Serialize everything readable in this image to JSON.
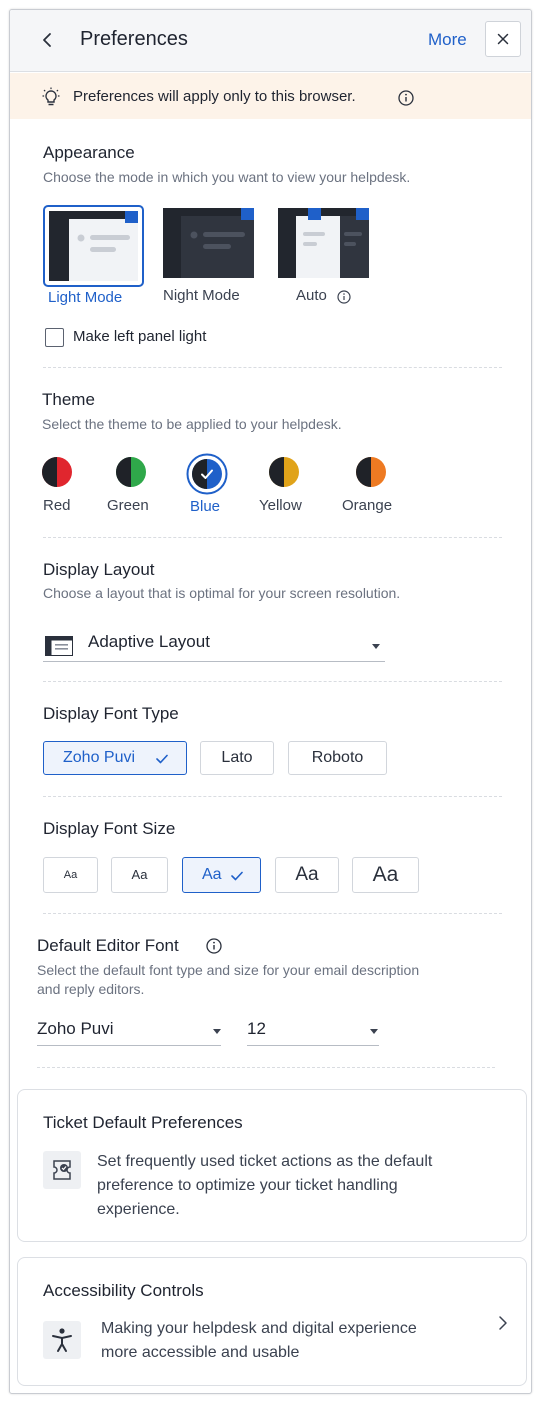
{
  "header": {
    "title": "Preferences",
    "more_label": "More"
  },
  "notice": {
    "text": "Preferences will apply only to this browser."
  },
  "appearance": {
    "title": "Appearance",
    "description": "Choose the mode in which you want to view your helpdesk.",
    "modes": [
      {
        "label": "Light Mode",
        "selected": true
      },
      {
        "label": "Night Mode",
        "selected": false
      },
      {
        "label": "Auto",
        "selected": false
      }
    ],
    "left_panel_label": "Make left panel light",
    "left_panel_checked": false
  },
  "theme": {
    "title": "Theme",
    "description": "Select the theme to be applied to your helpdesk.",
    "options": [
      {
        "label": "Red",
        "color": "#e0262e",
        "selected": false
      },
      {
        "label": "Green",
        "color": "#2fa84a",
        "selected": false
      },
      {
        "label": "Blue",
        "color": "#1f60c9",
        "selected": true
      },
      {
        "label": "Yellow",
        "color": "#e0a31a",
        "selected": false
      },
      {
        "label": "Orange",
        "color": "#ee7a22",
        "selected": false
      }
    ]
  },
  "display_layout": {
    "title": "Display Layout",
    "description": "Choose a layout that is optimal for your screen resolution.",
    "value": "Adaptive Layout"
  },
  "font_type": {
    "title": "Display Font Type",
    "options": [
      {
        "label": "Zoho Puvi",
        "selected": true
      },
      {
        "label": "Lato",
        "selected": false
      },
      {
        "label": "Roboto",
        "selected": false
      }
    ]
  },
  "font_size": {
    "title": "Display Font Size",
    "options": [
      {
        "label": "Aa",
        "selected": false
      },
      {
        "label": "Aa",
        "selected": false
      },
      {
        "label": "Aa",
        "selected": true
      },
      {
        "label": "Aa",
        "selected": false
      },
      {
        "label": "Aa",
        "selected": false
      }
    ]
  },
  "editor_font": {
    "title": "Default Editor Font",
    "description_line1": "Select the default font type and size for your email description",
    "description_line2": "and reply editors.",
    "font_value": "Zoho Puvi",
    "size_value": "12"
  },
  "ticket_defaults": {
    "title": "Ticket Default Preferences",
    "text_line1": "Set frequently used ticket actions as the default",
    "text_line2": "preference to optimize your ticket handling",
    "text_line3": "experience."
  },
  "accessibility": {
    "title": "Accessibility Controls",
    "text_line1": "Making your helpdesk and digital experience",
    "text_line2": "more accessible and usable"
  },
  "colors": {
    "accent": "#1f60c9",
    "notice_bg": "#fdf3e9"
  }
}
